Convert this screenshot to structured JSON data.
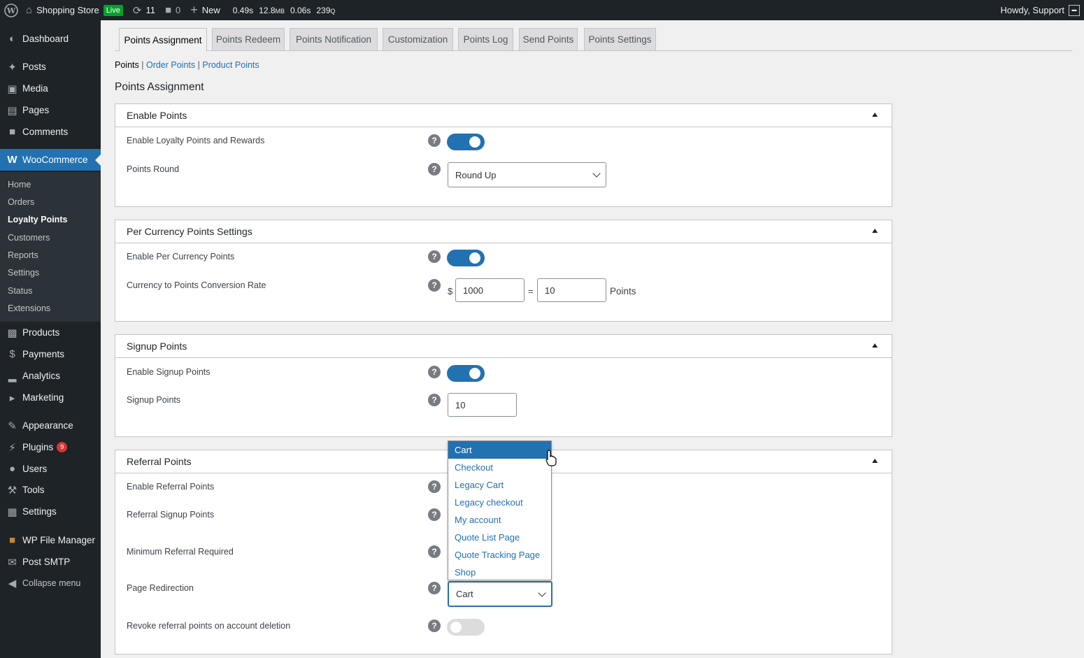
{
  "adminbar": {
    "site_name": "Shopping Store",
    "live_badge": "Live",
    "updates_count": "11",
    "comments_count": "0",
    "new_label": "New",
    "qm_time": "0.49s",
    "qm_memory": "12.8",
    "qm_memory_unit": "MB",
    "qm_db_time": "0.06s",
    "qm_queries": "239",
    "qm_queries_unit": "Q",
    "howdy": "Howdy, Support"
  },
  "sidebar": {
    "dashboard": "Dashboard",
    "posts": "Posts",
    "media": "Media",
    "pages": "Pages",
    "comments": "Comments",
    "woocommerce": "WooCommerce",
    "submenu": [
      "Home",
      "Orders",
      "Loyalty Points",
      "Customers",
      "Reports",
      "Settings",
      "Status",
      "Extensions"
    ],
    "products": "Products",
    "payments": "Payments",
    "analytics": "Analytics",
    "marketing": "Marketing",
    "appearance": "Appearance",
    "plugins": "Plugins",
    "plugins_badge": "9",
    "users": "Users",
    "tools": "Tools",
    "settings": "Settings",
    "file_manager": "WP File Manager",
    "post_smtp": "Post SMTP",
    "collapse": "Collapse menu"
  },
  "tabs": [
    "Points Assignment",
    "Points Redeem",
    "Points Notification",
    "Customization",
    "Points Log",
    "Send Points",
    "Points Settings"
  ],
  "subnav": {
    "current": "Points",
    "order_points": "Order Points",
    "product_points": "Product Points",
    "separator": "|"
  },
  "page_heading": "Points Assignment",
  "enable_points": {
    "title": "Enable Points",
    "enable_label": "Enable Loyalty Points and Rewards",
    "round_label": "Points Round",
    "round_value": "Round Up"
  },
  "per_currency": {
    "title": "Per Currency Points Settings",
    "enable_label": "Enable Per Currency Points",
    "rate_label": "Currency to Points Conversion Rate",
    "currency_symbol": "$",
    "currency_value": "1000",
    "equals": "=",
    "points_value": "10",
    "points_unit": "Points"
  },
  "signup": {
    "title": "Signup Points",
    "enable_label": "Enable Signup Points",
    "points_label": "Signup Points",
    "points_value": "10"
  },
  "referral": {
    "title": "Referral Points",
    "enable_label": "Enable Referral Points",
    "signup_label": "Referral Signup Points",
    "minimum_label": "Minimum Referral Required",
    "redirect_label": "Page Redirection",
    "redirect_value": "Cart",
    "revoke_label": "Revoke referral points on account deletion"
  },
  "dropdown_options": [
    "Cart",
    "Checkout",
    "Legacy Cart",
    "Legacy checkout",
    "My account",
    "Quote List Page",
    "Quote Tracking Page",
    "Shop"
  ],
  "help_glyph": "?",
  "colors": {
    "accent": "#2271b1",
    "adminbar": "#1d2327",
    "live": "#00a32a",
    "badge": "#d63638"
  }
}
